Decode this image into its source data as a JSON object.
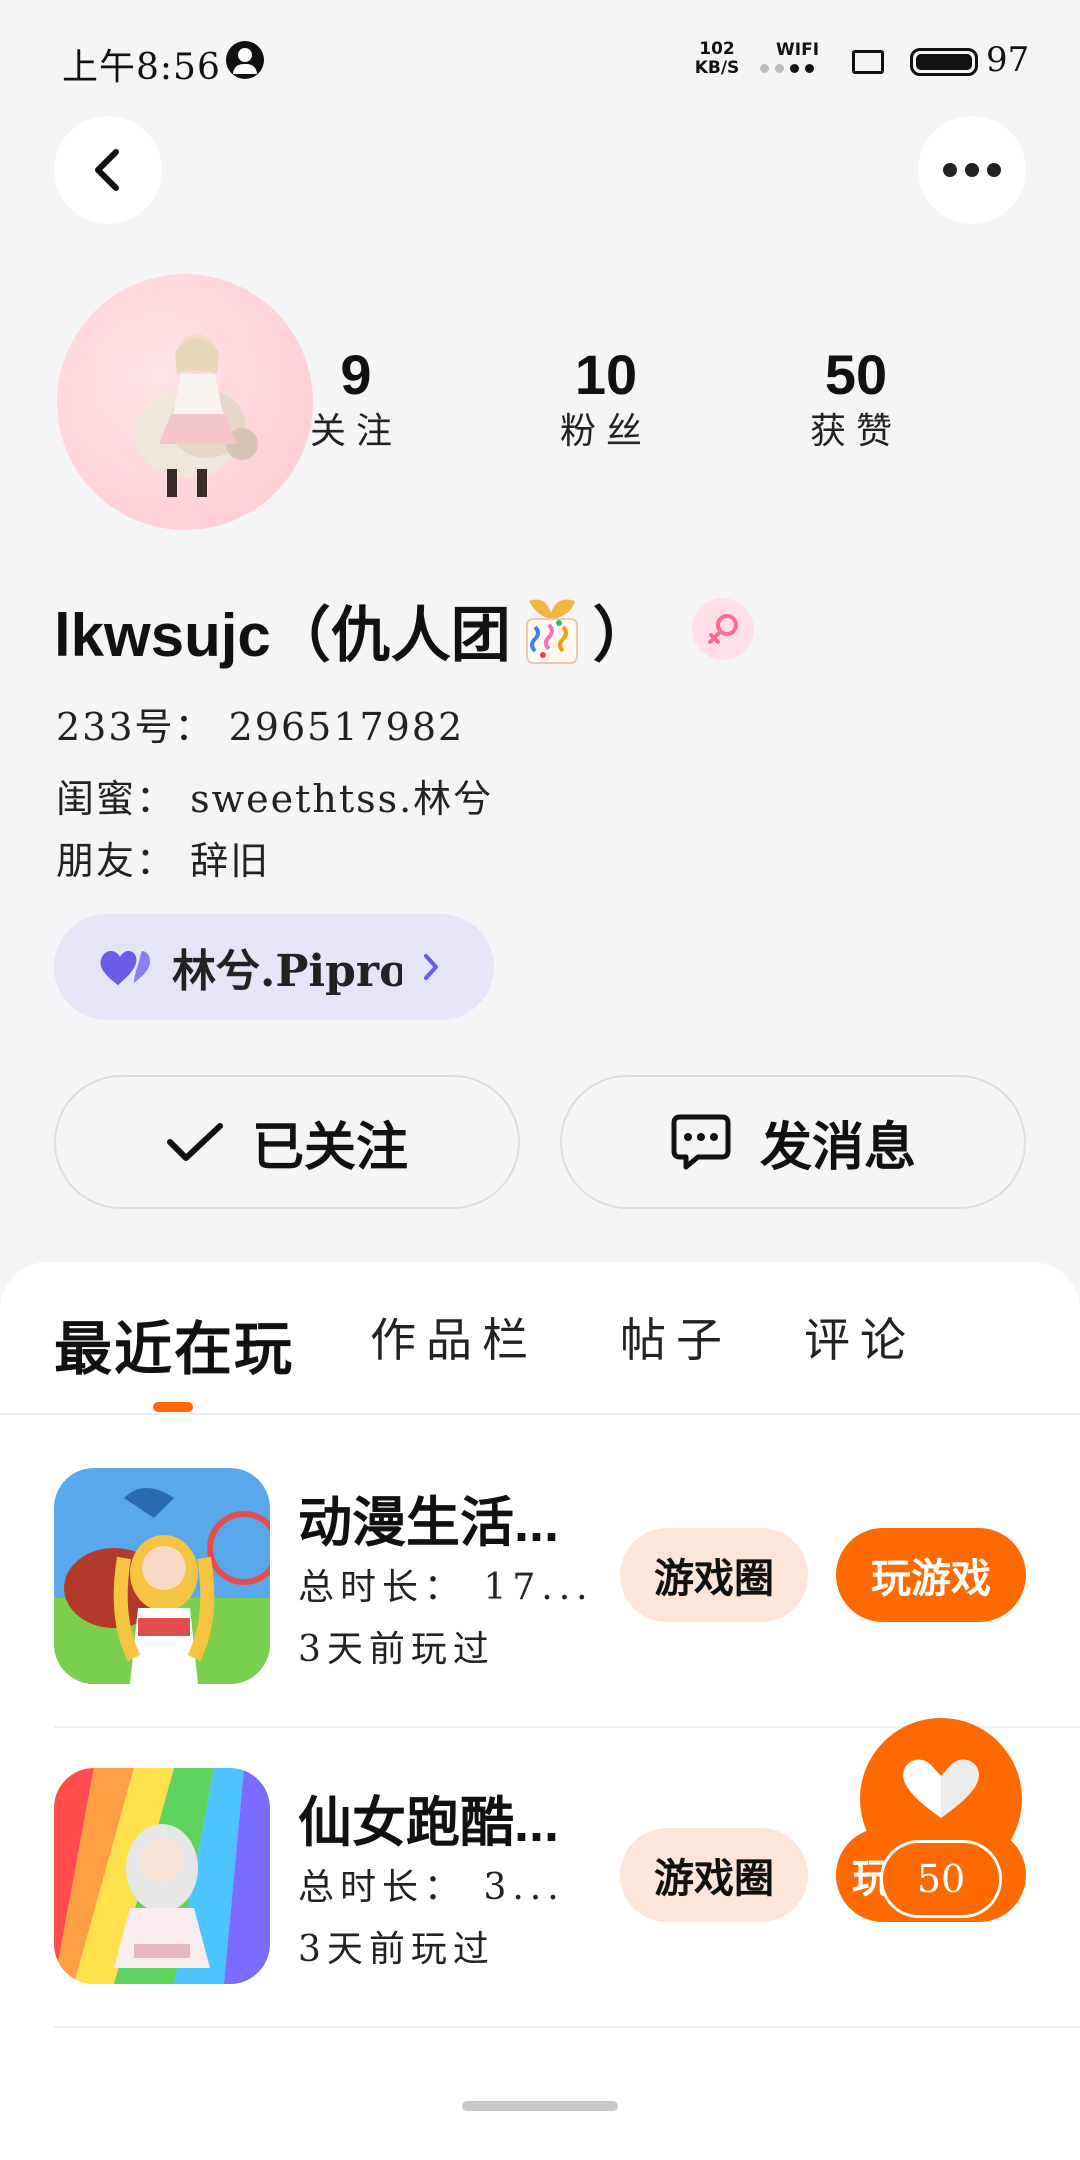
{
  "status_bar": {
    "time": "上午8:56",
    "net_speed": "102\nKB/S",
    "wifi_label": "WIFI",
    "battery": "97"
  },
  "header": {
    "back_icon": "chevron-left-icon",
    "more_icon": "more-horizontal-icon"
  },
  "profile": {
    "stats": [
      {
        "num": "9",
        "label": "关注"
      },
      {
        "num": "10",
        "label": "粉丝"
      },
      {
        "num": "50",
        "label": "获赞"
      }
    ],
    "username": "lkwsujc（仇人团",
    "username_close": "）",
    "id_line": "233号： 296517982",
    "relation_1": "闺蜜： sweethtss.林兮",
    "relation_2": "朋友： 辞旧",
    "cp_name": "林兮.Pipro",
    "gender_color": "#ff6b8e"
  },
  "actions": {
    "follow_label": "已关注",
    "message_label": "发消息"
  },
  "tabs": [
    {
      "label": "最近在玩",
      "active": true
    },
    {
      "label": "作品栏",
      "active": false
    },
    {
      "label": "帖子",
      "active": false
    },
    {
      "label": "评论",
      "active": false
    }
  ],
  "games": [
    {
      "title": "动漫生活...",
      "duration": "总时长： 17...",
      "last_played": "3天前玩过",
      "circle_label": "游戏圈",
      "play_label": "玩游戏"
    },
    {
      "title": "仙女跑酷...",
      "duration": "总时长： 3...",
      "last_played": "3天前玩过",
      "circle_label": "游戏圈",
      "play_label": "玩"
    }
  ],
  "like_fab": {
    "count": "50",
    "icon": "heart-icon"
  },
  "colors": {
    "accent": "#ff6a00",
    "pill_bg": "#fde6d9",
    "cp_bg": "#e6e4f7"
  }
}
